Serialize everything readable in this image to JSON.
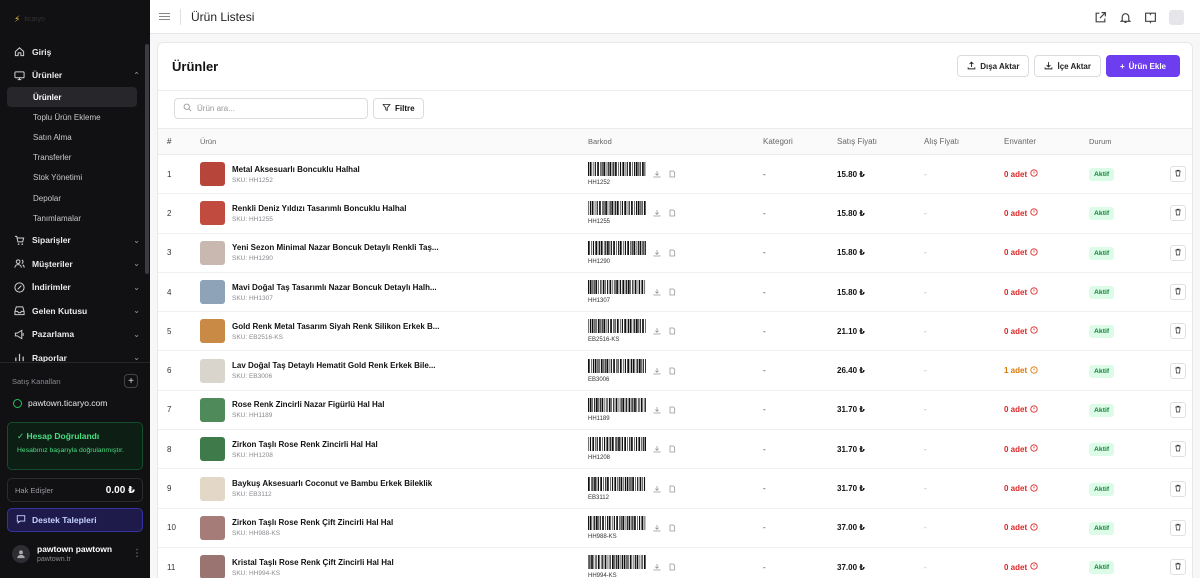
{
  "sidebar": {
    "logo_text": "ticaryo",
    "nav": [
      {
        "label": "Giriş",
        "icon": "home-icon",
        "chevron": ""
      },
      {
        "label": "Ürünler",
        "icon": "monitor-icon",
        "chevron": "⌃"
      }
    ],
    "subitems": [
      "Ürünler",
      "Toplu Ürün Ekleme",
      "Satın Alma",
      "Transferler",
      "Stok Yönetimi",
      "Depolar",
      "Tanımlamalar"
    ],
    "nav2": [
      {
        "label": "Siparişler",
        "icon": "cart-icon"
      },
      {
        "label": "Müşteriler",
        "icon": "users-icon"
      },
      {
        "label": "İndirimler",
        "icon": "percent-icon"
      },
      {
        "label": "Gelen Kutusu",
        "icon": "inbox-icon"
      },
      {
        "label": "Pazarlama",
        "icon": "megaphone-icon"
      },
      {
        "label": "Raporlar",
        "icon": "chart-icon"
      }
    ],
    "channels_label": "Satış Kanalları",
    "domain": "pawtown.ticaryo.com",
    "verify_title": "Hesap Doğrulandı",
    "verify_sub": "Hesabınız başarıyla doğrulanmıştır.",
    "balance_label": "Hak Edişler",
    "balance_value": "0.00 ₺",
    "support_label": "Destek Talepleri",
    "user_name": "pawtown pawtown",
    "user_domain": "pawtown.tr"
  },
  "topbar": {
    "title": "Ürün Listesi"
  },
  "page": {
    "title": "Ürünler",
    "export_label": "Dışa Aktar",
    "import_label": "İçe Aktar",
    "add_label": "Ürün Ekle",
    "search_placeholder": "Ürün ara...",
    "filter_label": "Filtre"
  },
  "table": {
    "headers": [
      "#",
      "Ürün",
      "Barkod",
      "Kategori",
      "Satış Fiyatı",
      "Alış Fiyatı",
      "Envanter",
      "Durum"
    ],
    "rows": [
      {
        "num": "1",
        "name": "Metal Aksesuarlı Boncuklu Halhal",
        "sku": "SKU: HH1252",
        "barcode": "HH1252",
        "category": "-",
        "price": "15.80 ₺",
        "buy": "-",
        "stock": "0 adet",
        "stock_level": "red",
        "status": "Aktif",
        "thumb": "#b8453a"
      },
      {
        "num": "2",
        "name": "Renkli Deniz Yıldızı Tasarımlı Boncuklu Halhal",
        "sku": "SKU: HH1255",
        "barcode": "HH1255",
        "category": "-",
        "price": "15.80 ₺",
        "buy": "-",
        "stock": "0 adet",
        "stock_level": "red",
        "status": "Aktif",
        "thumb": "#c24b3f"
      },
      {
        "num": "3",
        "name": "Yeni Sezon Minimal Nazar Boncuk Detaylı Renkli Taş...",
        "sku": "SKU: HH1290",
        "barcode": "HH1290",
        "category": "-",
        "price": "15.80 ₺",
        "buy": "-",
        "stock": "0 adet",
        "stock_level": "red",
        "status": "Aktif",
        "thumb": "#c9b8b0"
      },
      {
        "num": "4",
        "name": "Mavi Doğal Taş Tasarımlı Nazar Boncuk Detaylı Halh...",
        "sku": "SKU: HH1307",
        "barcode": "HH1307",
        "category": "-",
        "price": "15.80 ₺",
        "buy": "-",
        "stock": "0 adet",
        "stock_level": "red",
        "status": "Aktif",
        "thumb": "#8fa3b8"
      },
      {
        "num": "5",
        "name": "Gold Renk Metal Tasarım Siyah Renk Silikon Erkek B...",
        "sku": "SKU: EB2516-KS",
        "barcode": "EB2516-KS",
        "category": "-",
        "price": "21.10 ₺",
        "buy": "-",
        "stock": "0 adet",
        "stock_level": "red",
        "status": "Aktif",
        "thumb": "#c98a45"
      },
      {
        "num": "6",
        "name": "Lav Doğal Taş Detaylı Hematit Gold Renk Erkek Bile...",
        "sku": "SKU: EB3006",
        "barcode": "EB3006",
        "category": "-",
        "price": "26.40 ₺",
        "buy": "-",
        "stock": "1 adet",
        "stock_level": "amber",
        "status": "Aktif",
        "thumb": "#d9d4cc"
      },
      {
        "num": "7",
        "name": "Rose Renk Zincirli Nazar Figürlü Hal Hal",
        "sku": "SKU: HH1189",
        "barcode": "HH1189",
        "category": "-",
        "price": "31.70 ₺",
        "buy": "-",
        "stock": "0 adet",
        "stock_level": "red",
        "status": "Aktif",
        "thumb": "#4f8a5a"
      },
      {
        "num": "8",
        "name": "Zirkon Taşlı Rose Renk Zincirli Hal Hal",
        "sku": "SKU: HH1208",
        "barcode": "HH1208",
        "category": "-",
        "price": "31.70 ₺",
        "buy": "-",
        "stock": "0 adet",
        "stock_level": "red",
        "status": "Aktif",
        "thumb": "#3f7a4a"
      },
      {
        "num": "9",
        "name": "Baykuş Aksesuarlı Coconut ve Bambu Erkek Bileklik",
        "sku": "SKU: EB3112",
        "barcode": "EB3112",
        "category": "-",
        "price": "31.70 ₺",
        "buy": "-",
        "stock": "0 adet",
        "stock_level": "red",
        "status": "Aktif",
        "thumb": "#e3d7c8"
      },
      {
        "num": "10",
        "name": "Zirkon Taşlı Rose Renk Çift Zincirli Hal Hal",
        "sku": "SKU: HH988-KS",
        "barcode": "HH988-KS",
        "category": "-",
        "price": "37.00 ₺",
        "buy": "-",
        "stock": "0 adet",
        "stock_level": "red",
        "status": "Aktif",
        "thumb": "#a67c78"
      },
      {
        "num": "11",
        "name": "Kristal Taşlı Rose Renk Çift Zincirli Hal Hal",
        "sku": "SKU: HH994-KS",
        "barcode": "HH994-KS",
        "category": "-",
        "price": "37.00 ₺",
        "buy": "-",
        "stock": "0 adet",
        "stock_level": "red",
        "status": "Aktif",
        "thumb": "#9a7470"
      }
    ]
  },
  "colors": {
    "accent": "#6d3ef0",
    "success": "#22c55e",
    "danger": "#dc2626",
    "warning": "#d97706"
  }
}
